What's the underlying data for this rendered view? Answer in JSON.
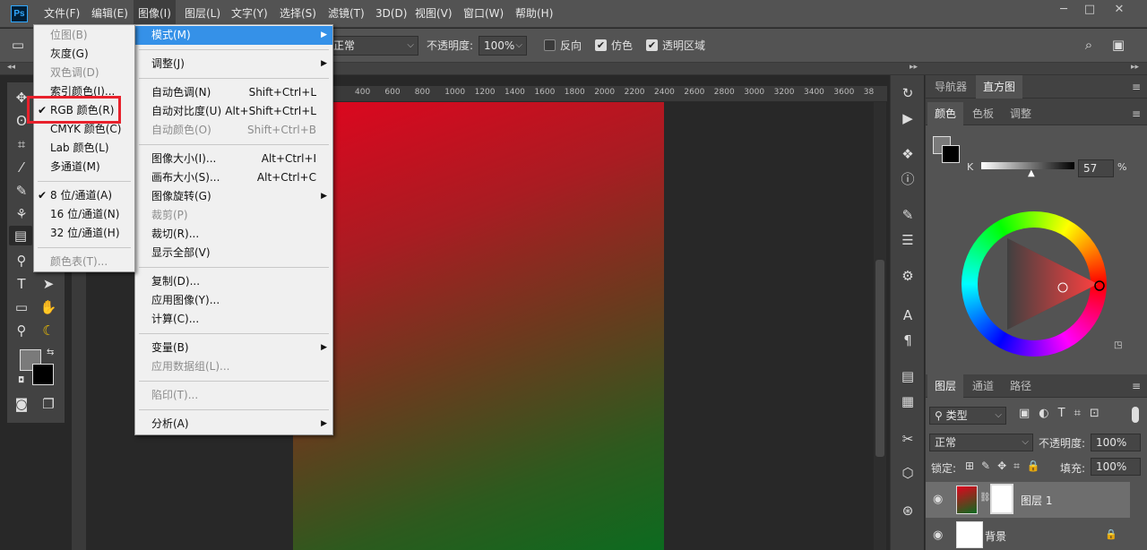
{
  "app": {
    "logo": "Ps"
  },
  "menubar": {
    "items": [
      "文件(F)",
      "编辑(E)",
      "图像(I)",
      "图层(L)",
      "文字(Y)",
      "选择(S)",
      "滤镜(T)",
      "3D(D)",
      "视图(V)",
      "窗口(W)",
      "帮助(H)"
    ],
    "active": "图像(I)"
  },
  "window_controls": {
    "minimize": "─",
    "maximize": "□",
    "close": "✕"
  },
  "options": {
    "mode_value": "正常",
    "opacity_label": "不透明度:",
    "opacity_value": "100%",
    "reverse_label": "反向",
    "dither_label": "仿色",
    "transparency_label": "透明区域",
    "reverse_checked": false,
    "dither_checked": true,
    "transparency_checked": true
  },
  "ruler": {
    "ticks": [
      "400",
      "600",
      "800",
      "1000",
      "1200",
      "1400",
      "1600",
      "1800",
      "2000",
      "2200",
      "2400",
      "2600",
      "2800",
      "3000",
      "3200",
      "3400",
      "3600",
      "38"
    ]
  },
  "image_menu": {
    "groups": [
      [
        {
          "label": "模式(M)",
          "sub": true,
          "selected": true
        }
      ],
      [
        {
          "label": "调整(J)",
          "sub": true
        }
      ],
      [
        {
          "label": "自动色调(N)",
          "shortcut": "Shift+Ctrl+L"
        },
        {
          "label": "自动对比度(U)",
          "shortcut": "Alt+Shift+Ctrl+L"
        },
        {
          "label": "自动颜色(O)",
          "shortcut": "Shift+Ctrl+B",
          "disabled": true
        }
      ],
      [
        {
          "label": "图像大小(I)...",
          "shortcut": "Alt+Ctrl+I"
        },
        {
          "label": "画布大小(S)...",
          "shortcut": "Alt+Ctrl+C"
        },
        {
          "label": "图像旋转(G)",
          "sub": true
        },
        {
          "label": "裁剪(P)",
          "disabled": true
        },
        {
          "label": "裁切(R)..."
        },
        {
          "label": "显示全部(V)"
        }
      ],
      [
        {
          "label": "复制(D)..."
        },
        {
          "label": "应用图像(Y)..."
        },
        {
          "label": "计算(C)..."
        }
      ],
      [
        {
          "label": "变量(B)",
          "sub": true
        },
        {
          "label": "应用数据组(L)...",
          "disabled": true
        }
      ],
      [
        {
          "label": "陷印(T)...",
          "disabled": true
        }
      ],
      [
        {
          "label": "分析(A)",
          "sub": true
        }
      ]
    ]
  },
  "mode_menu": {
    "groups": [
      [
        {
          "label": "位图(B)",
          "disabled": true
        },
        {
          "label": "灰度(G)"
        },
        {
          "label": "双色调(D)",
          "disabled": true
        },
        {
          "label": "索引颜色(I)..."
        },
        {
          "label": "RGB 颜色(R)",
          "checked": true
        },
        {
          "label": "CMYK 颜色(C)"
        },
        {
          "label": "Lab 颜色(L)"
        },
        {
          "label": "多通道(M)"
        }
      ],
      [
        {
          "label": "8 位/通道(A)",
          "checked": true
        },
        {
          "label": "16 位/通道(N)"
        },
        {
          "label": "32 位/通道(H)"
        }
      ],
      [
        {
          "label": "颜色表(T)...",
          "disabled": true
        }
      ]
    ]
  },
  "panels": {
    "top_tabs": [
      "导航器",
      "直方图"
    ],
    "top_active": "直方图",
    "color_tabs": [
      "颜色",
      "色板",
      "调整"
    ],
    "color_active": "颜色",
    "k_label": "K",
    "k_value": "57",
    "k_unit": "%",
    "layer_tabs": [
      "图层",
      "通道",
      "路径"
    ],
    "layer_active": "图层",
    "filter_kind": "类型",
    "blend_mode": "正常",
    "opacity_label": "不透明度:",
    "opacity_value": "100%",
    "lock_label": "锁定:",
    "fill_label": "填充:",
    "fill_value": "100%",
    "layers": [
      {
        "name": "图层 1"
      },
      {
        "name": "背景"
      }
    ],
    "panel_menu": "≡"
  },
  "colors": {
    "accent": "#3591e8",
    "highlight": "#e8212c"
  }
}
